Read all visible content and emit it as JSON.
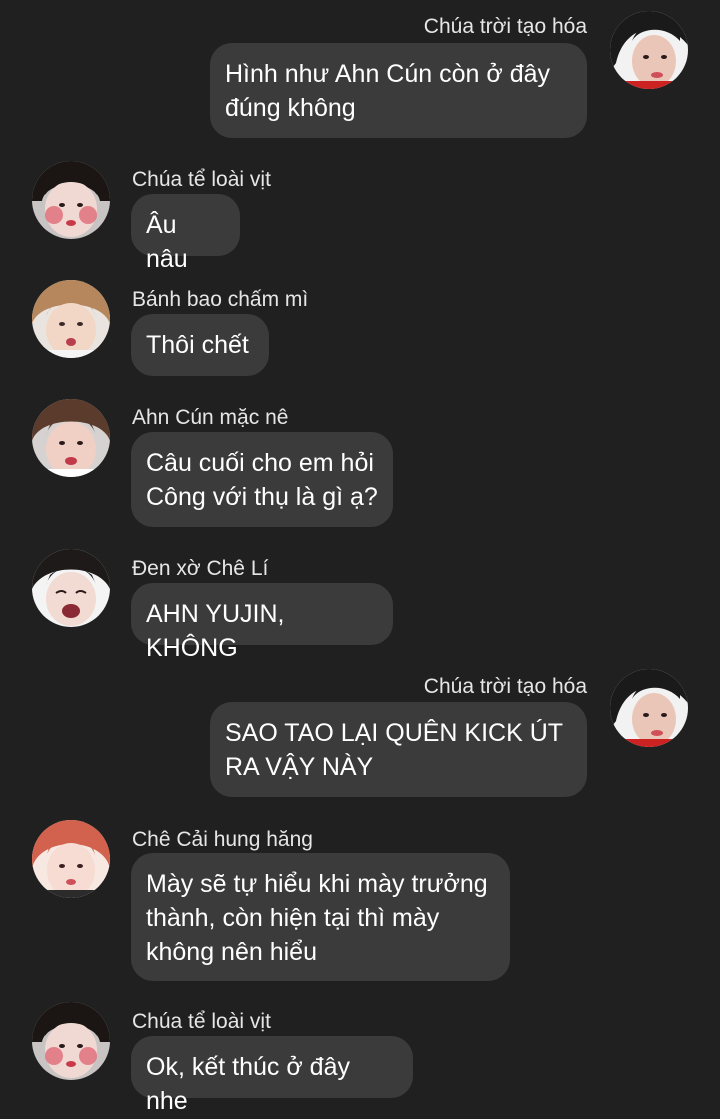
{
  "messages": [
    {
      "sender": "Chúa trời tạo hóa",
      "text": "Hình như Ahn Cún còn ở đây\nđúng không",
      "side": "out",
      "avatar_icon": "woman-avatar-icon"
    },
    {
      "sender": "Chúa tể loài vịt",
      "text": "Âu nâu",
      "side": "in",
      "avatar_icon": "girl-blush-avatar-icon"
    },
    {
      "sender": "Bánh bao chấm mì",
      "text": "Thôi chết",
      "side": "in",
      "avatar_icon": "girl-pout-avatar-icon"
    },
    {
      "sender": "Ahn Cún mặc nê",
      "text": "Câu cuối cho em hỏi\nCông với thụ là gì ạ?",
      "side": "in",
      "avatar_icon": "girl-pout-avatar-icon"
    },
    {
      "sender": "Đen xờ Chê Lí",
      "text": "AHN YUJIN, KHÔNG",
      "side": "in",
      "avatar_icon": "girl-shout-avatar-icon"
    },
    {
      "sender": "Chúa trời tạo hóa",
      "text": "SAO TAO LẠI QUÊN KICK ÚT\nRA VẬY NÀY",
      "side": "out",
      "avatar_icon": "woman-avatar-icon"
    },
    {
      "sender": "Chê Cải hung hăng",
      "text": "Mày sẽ tự hiểu khi mày trưởng\nthành, còn hiện tại thì mày\nkhông nên hiểu",
      "side": "in",
      "avatar_icon": "redhair-avatar-icon"
    },
    {
      "sender": "Chúa tể loài vịt",
      "text": "Ok, kết thúc ở đây nhe",
      "side": "in",
      "avatar_icon": "girl-blush-avatar-icon"
    }
  ],
  "colors": {
    "background": "#202020",
    "bubble": "#3b3b3b",
    "text": "#ffffff"
  }
}
